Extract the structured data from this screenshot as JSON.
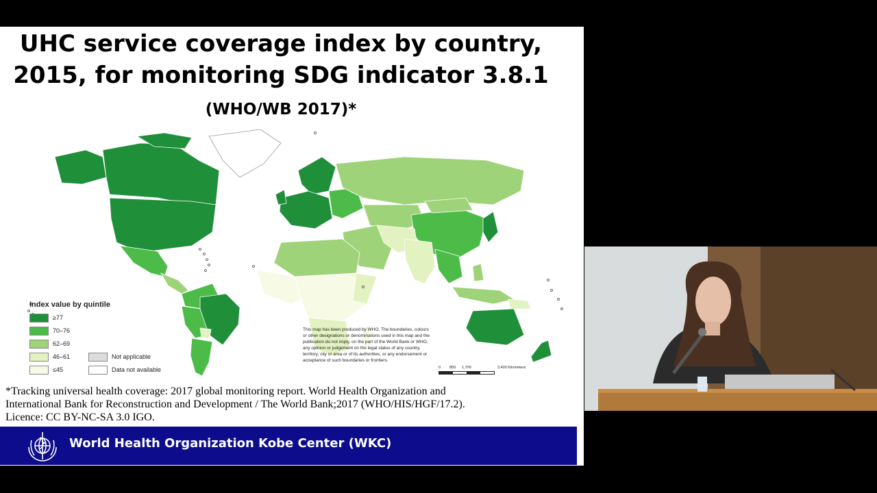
{
  "slide": {
    "title_main": "UHC service coverage index by country, 2015, for monitoring SDG indicator 3.8.1",
    "title_suffix": "(WHO/WB 2017)*",
    "legend": {
      "title": "Index value by quintile",
      "items": [
        {
          "label": "≥77",
          "color": "#1f8f3a"
        },
        {
          "label": "70–76",
          "color": "#4cbb47"
        },
        {
          "label": "62–69",
          "color": "#9fd37a"
        },
        {
          "label": "46–61",
          "color": "#e2f2c0"
        },
        {
          "label": "≤45",
          "color": "#f7fbe6"
        }
      ],
      "extra": [
        {
          "label": "Not applicable",
          "color": "#dcdcdc"
        },
        {
          "label": "Data not available",
          "color": "#ffffff"
        }
      ]
    },
    "disclaimer": "This map has been produced by WHO. The boundaries, colours or other designations or denominations used in this map and the publication do not imply, on the part of the World Bank or WHO, any opinion or judgement on the legal status of any country, territory, city or area or of its authorities, or any endorsement or acceptance of such boundaries or frontiers.",
    "scale": {
      "labels": [
        "0",
        "850",
        "1,700",
        "3,400 Kilometers"
      ]
    },
    "footnote_lines": [
      "*Tracking universal health coverage: 2017 global monitoring report. World Health Organization and",
      "International Bank for Reconstruction and Development / The World Bank;2017  (WHO/HIS/HGF/17.2).",
      "Licence: CC BY-NC-SA 3.0 IGO."
    ],
    "banner": {
      "name": "World Health Organization Kobe Center (WKC)"
    }
  }
}
